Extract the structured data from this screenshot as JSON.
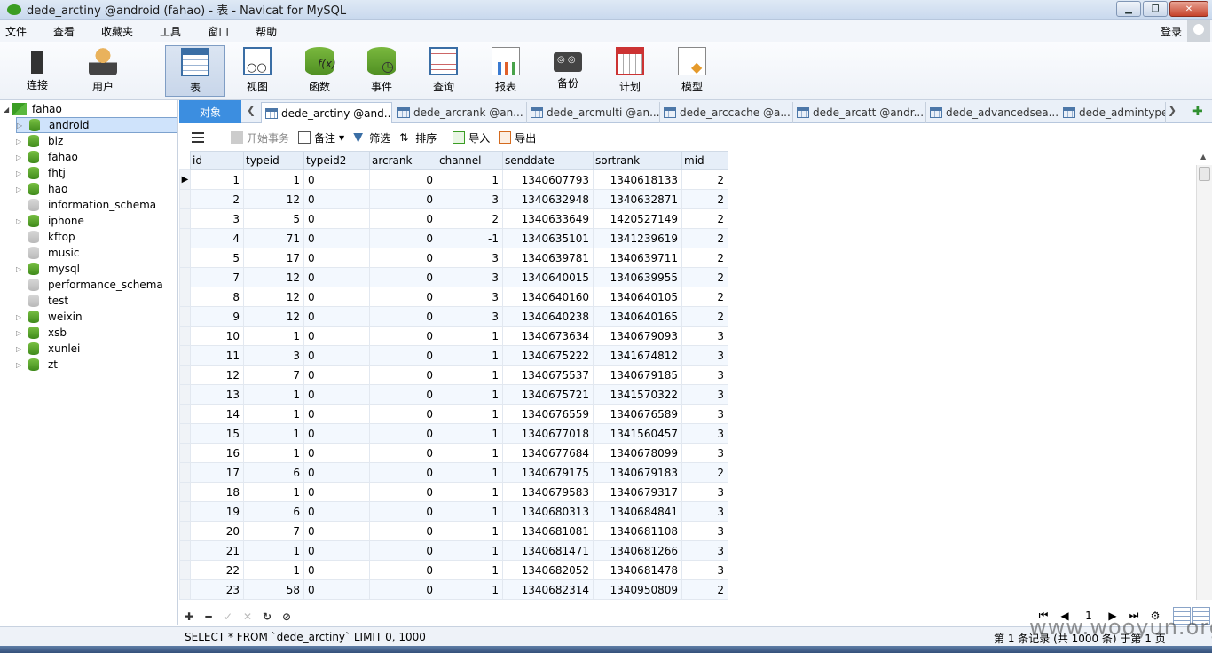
{
  "window": {
    "title": "dede_arctiny @android (fahao) - 表 - Navicat for MySQL"
  },
  "menu": [
    "文件",
    "查看",
    "收藏夹",
    "工具",
    "窗口",
    "帮助"
  ],
  "login_label": "登录",
  "toolbar": {
    "items": [
      {
        "label": "连接",
        "icon": "plug-icon"
      },
      {
        "label": "用户",
        "icon": "user-icon"
      },
      {
        "label": "表",
        "icon": "table-icon"
      },
      {
        "label": "视图",
        "icon": "view-icon"
      },
      {
        "label": "函数",
        "icon": "function-icon"
      },
      {
        "label": "事件",
        "icon": "event-icon"
      },
      {
        "label": "查询",
        "icon": "query-icon"
      },
      {
        "label": "报表",
        "icon": "report-icon"
      },
      {
        "label": "备份",
        "icon": "backup-icon"
      },
      {
        "label": "计划",
        "icon": "schedule-icon"
      },
      {
        "label": "模型",
        "icon": "model-icon"
      }
    ]
  },
  "tree": {
    "connection": "fahao",
    "databases": [
      {
        "name": "android",
        "active": true
      },
      {
        "name": "biz",
        "active": true
      },
      {
        "name": "fahao",
        "active": true
      },
      {
        "name": "fhtj",
        "active": true
      },
      {
        "name": "hao",
        "active": true
      },
      {
        "name": "information_schema",
        "active": false
      },
      {
        "name": "iphone",
        "active": true
      },
      {
        "name": "kftop",
        "active": false
      },
      {
        "name": "music",
        "active": false
      },
      {
        "name": "mysql",
        "active": true
      },
      {
        "name": "performance_schema",
        "active": false
      },
      {
        "name": "test",
        "active": false
      },
      {
        "name": "weixin",
        "active": true
      },
      {
        "name": "xsb",
        "active": true
      },
      {
        "name": "xunlei",
        "active": true
      },
      {
        "name": "zt",
        "active": true
      }
    ]
  },
  "tabs": {
    "object_label": "对象",
    "items": [
      "dede_arctiny @and...",
      "dede_arcrank @an...",
      "dede_arcmulti @an...",
      "dede_arccache @a...",
      "dede_arcatt @andr...",
      "dede_advancedsea...",
      "dede_admintype"
    ]
  },
  "gridtools": {
    "begin_transaction": "开始事务",
    "memo": "备注",
    "filter": "筛选",
    "sort": "排序",
    "import": "导入",
    "export": "导出"
  },
  "table": {
    "columns": [
      "id",
      "typeid",
      "typeid2",
      "arcrank",
      "channel",
      "senddate",
      "sortrank",
      "mid"
    ],
    "rows": [
      [
        "1",
        "1",
        "0",
        "0",
        "1",
        "1340607793",
        "1340618133",
        "2"
      ],
      [
        "2",
        "12",
        "0",
        "0",
        "3",
        "1340632948",
        "1340632871",
        "2"
      ],
      [
        "3",
        "5",
        "0",
        "0",
        "2",
        "1340633649",
        "1420527149",
        "2"
      ],
      [
        "4",
        "71",
        "0",
        "0",
        "-1",
        "1340635101",
        "1341239619",
        "2"
      ],
      [
        "5",
        "17",
        "0",
        "0",
        "3",
        "1340639781",
        "1340639711",
        "2"
      ],
      [
        "7",
        "12",
        "0",
        "0",
        "3",
        "1340640015",
        "1340639955",
        "2"
      ],
      [
        "8",
        "12",
        "0",
        "0",
        "3",
        "1340640160",
        "1340640105",
        "2"
      ],
      [
        "9",
        "12",
        "0",
        "0",
        "3",
        "1340640238",
        "1340640165",
        "2"
      ],
      [
        "10",
        "1",
        "0",
        "0",
        "1",
        "1340673634",
        "1340679093",
        "3"
      ],
      [
        "11",
        "3",
        "0",
        "0",
        "1",
        "1340675222",
        "1341674812",
        "3"
      ],
      [
        "12",
        "7",
        "0",
        "0",
        "1",
        "1340675537",
        "1340679185",
        "3"
      ],
      [
        "13",
        "1",
        "0",
        "0",
        "1",
        "1340675721",
        "1341570322",
        "3"
      ],
      [
        "14",
        "1",
        "0",
        "0",
        "1",
        "1340676559",
        "1340676589",
        "3"
      ],
      [
        "15",
        "1",
        "0",
        "0",
        "1",
        "1340677018",
        "1341560457",
        "3"
      ],
      [
        "16",
        "1",
        "0",
        "0",
        "1",
        "1340677684",
        "1340678099",
        "3"
      ],
      [
        "17",
        "6",
        "0",
        "0",
        "1",
        "1340679175",
        "1340679183",
        "2"
      ],
      [
        "18",
        "1",
        "0",
        "0",
        "1",
        "1340679583",
        "1340679317",
        "3"
      ],
      [
        "19",
        "6",
        "0",
        "0",
        "1",
        "1340680313",
        "1340684841",
        "3"
      ],
      [
        "20",
        "7",
        "0",
        "0",
        "1",
        "1340681081",
        "1340681108",
        "3"
      ],
      [
        "21",
        "1",
        "0",
        "0",
        "1",
        "1340681471",
        "1340681266",
        "3"
      ],
      [
        "22",
        "1",
        "0",
        "0",
        "1",
        "1340682052",
        "1340681478",
        "3"
      ],
      [
        "23",
        "58",
        "0",
        "0",
        "1",
        "1340682314",
        "1340950809",
        "2"
      ]
    ]
  },
  "pager": {
    "page": "1"
  },
  "status": {
    "sql": "SELECT * FROM `dede_arctiny` LIMIT 0, 1000",
    "records": "第 1 条记录 (共 1000 条) 于第 1 页"
  },
  "watermark": "www.wooyun.org"
}
